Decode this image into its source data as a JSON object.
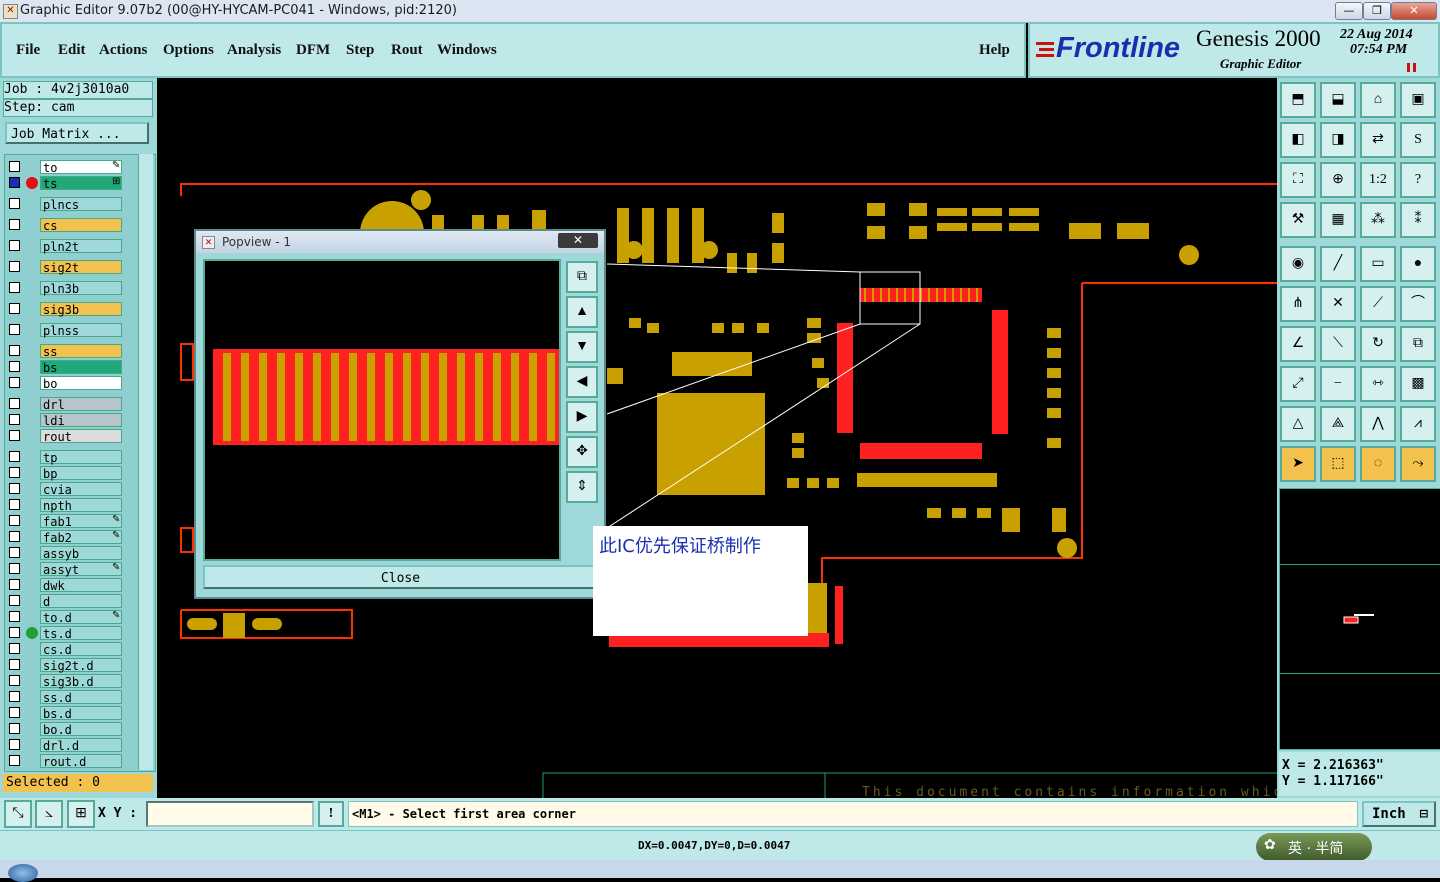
{
  "window": {
    "title": "Graphic Editor 9.07b2 (00@HY-HYCAM-PC041 - Windows, pid:2120)",
    "buttons": {
      "minimize": "—",
      "restore": "❐",
      "close": "✕"
    }
  },
  "menubar": {
    "items": [
      "File",
      "Edit",
      "Actions",
      "Options",
      "Analysis",
      "DFM",
      "Step",
      "Rout",
      "Windows"
    ],
    "help": "Help"
  },
  "brand": {
    "logo": "Frontline",
    "product": "Genesis 2000",
    "subtitle": "Graphic Editor",
    "date": "22 Aug 2014",
    "time": "07:54 PM"
  },
  "job": {
    "job_label": "Job : 4v2j3010a0",
    "step_label": "Step: cam",
    "matrix_button": "Job Matrix ..."
  },
  "layers": [
    {
      "name": "to",
      "color": "#ffffff",
      "mark": "pen"
    },
    {
      "name": "ts",
      "color": "#20a878",
      "mark": "grid",
      "active": true
    },
    {
      "name": "plncs",
      "color": "#9fd8d8"
    },
    {
      "name": "cs",
      "color": "#f2c14e"
    },
    {
      "name": "pln2t",
      "color": "#9fd8d8"
    },
    {
      "name": "sig2t",
      "color": "#f2c14e"
    },
    {
      "name": "pln3b",
      "color": "#9fd8d8"
    },
    {
      "name": "sig3b",
      "color": "#f2c14e"
    },
    {
      "name": "plnss",
      "color": "#9fd8d8"
    },
    {
      "name": "ss",
      "color": "#f2c14e"
    },
    {
      "name": "bs",
      "color": "#20a878"
    },
    {
      "name": "bo",
      "color": "#ffffff"
    },
    {
      "name": "drl",
      "color": "#b8c4cc"
    },
    {
      "name": "ldi",
      "color": "#b8c4cc"
    },
    {
      "name": "rout",
      "color": "#dcdcdc"
    },
    {
      "name": "tp",
      "color": "#9fd8d8"
    },
    {
      "name": "bp",
      "color": "#9fd8d8"
    },
    {
      "name": "cvia",
      "color": "#9fd8d8"
    },
    {
      "name": "npth",
      "color": "#9fd8d8"
    },
    {
      "name": "fab1",
      "color": "#9fd8d8",
      "mark": "pen"
    },
    {
      "name": "fab2",
      "color": "#9fd8d8",
      "mark": "pen"
    },
    {
      "name": "assyb",
      "color": "#9fd8d8"
    },
    {
      "name": "assyt",
      "color": "#9fd8d8",
      "mark": "pen"
    },
    {
      "name": "dwk",
      "color": "#9fd8d8"
    },
    {
      "name": "d",
      "color": "#9fd8d8"
    },
    {
      "name": "to.d",
      "color": "#9fd8d8",
      "mark": "pen"
    },
    {
      "name": "ts.d",
      "color": "#9fd8d8"
    },
    {
      "name": "cs.d",
      "color": "#9fd8d8"
    },
    {
      "name": "sig2t.d",
      "color": "#9fd8d8"
    },
    {
      "name": "sig3b.d",
      "color": "#9fd8d8"
    },
    {
      "name": "ss.d",
      "color": "#9fd8d8"
    },
    {
      "name": "bs.d",
      "color": "#9fd8d8"
    },
    {
      "name": "bo.d",
      "color": "#9fd8d8"
    },
    {
      "name": "drl.d",
      "color": "#9fd8d8"
    },
    {
      "name": "rout.d",
      "color": "#9fd8d8"
    }
  ],
  "selected_label": "Selected : 0",
  "popview": {
    "title": "Popview - 1",
    "close_label": "Close"
  },
  "note": "此IC优先保证桥制作",
  "canvas_footer_text": "This document contains information which",
  "coords": {
    "x": "X = 2.216363\"",
    "y": "Y = 1.117166\""
  },
  "bottombar": {
    "xy_label": "X Y :",
    "xy_value": "",
    "prompt": "<M1> - Select first area corner",
    "units": "Inch"
  },
  "statusbar": {
    "text": "DX=0.0047,DY=0,D=0.0047"
  },
  "ime": {
    "text": "英 · 半简"
  },
  "colors": {
    "panel": "#9fd8d8",
    "copper": "#c8a000",
    "outline": "#ff3000",
    "highlight": "#ff2020"
  }
}
